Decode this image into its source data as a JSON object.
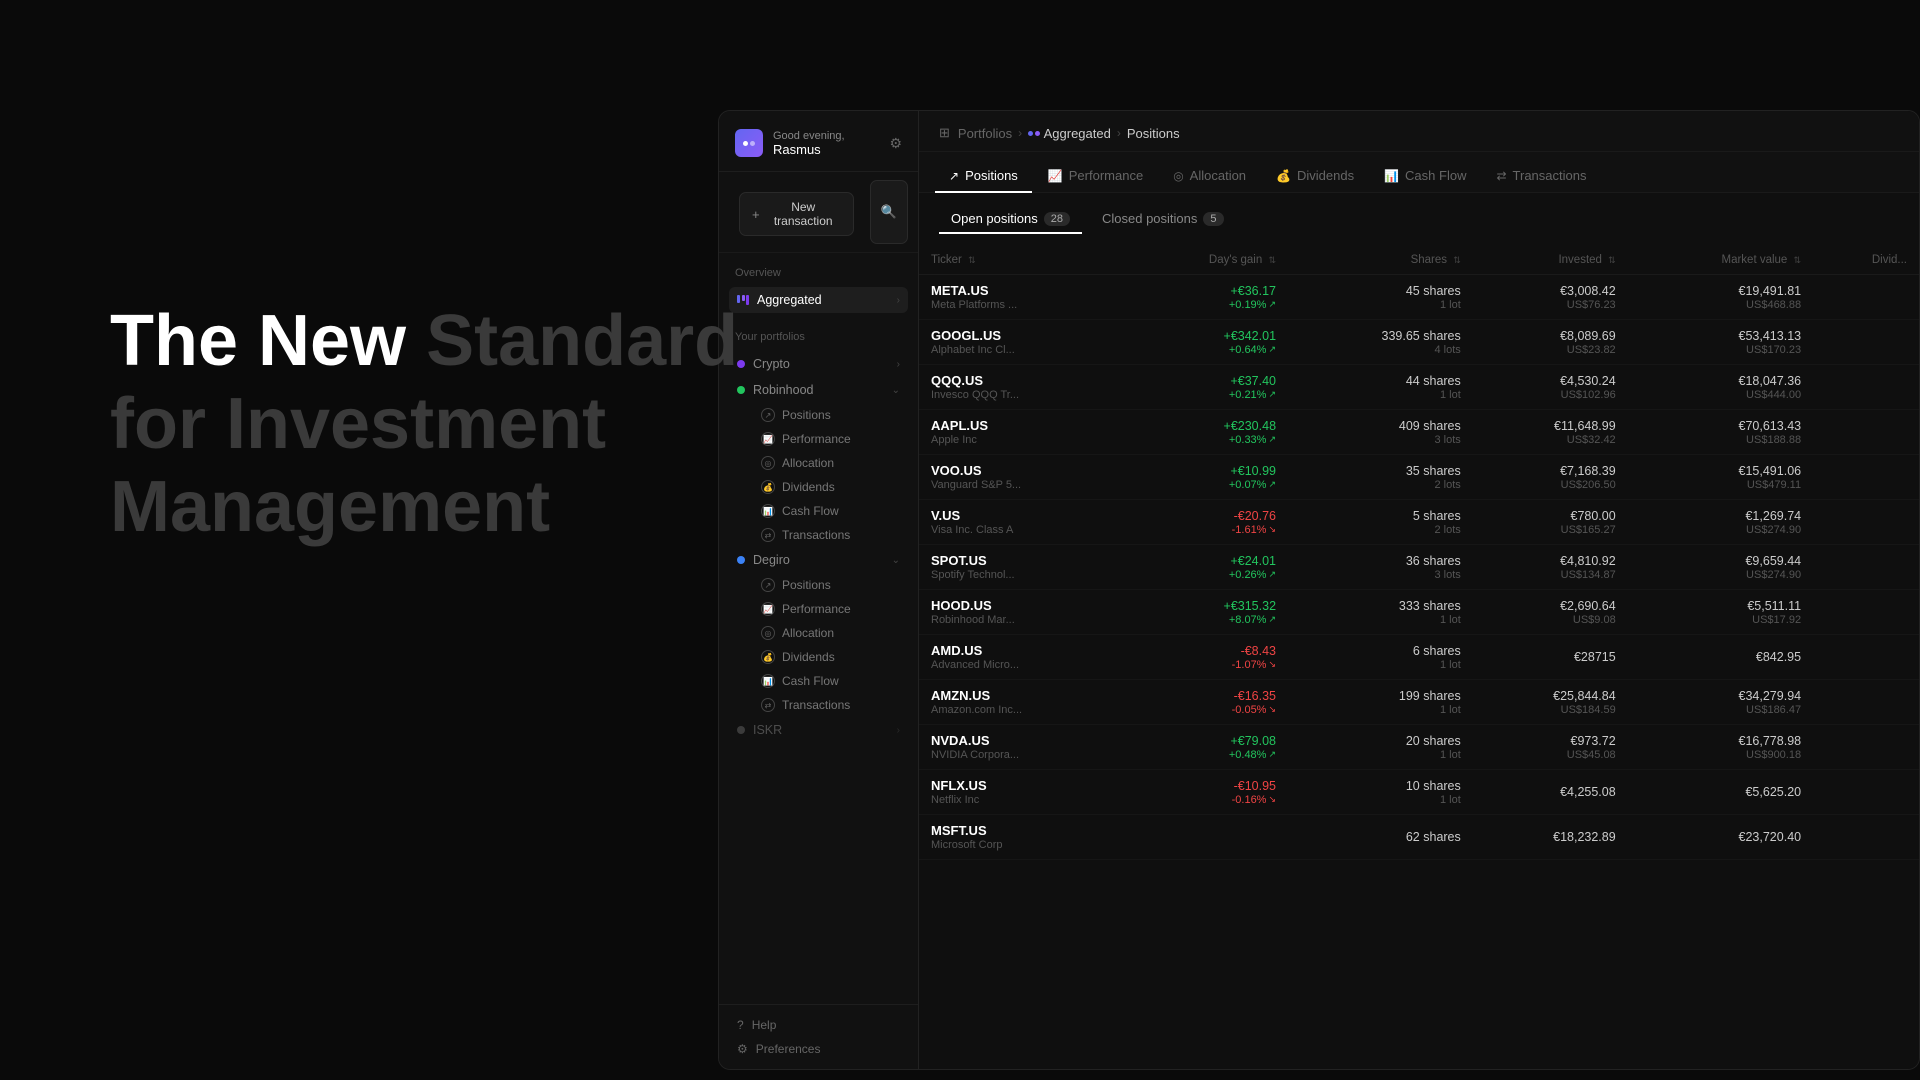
{
  "hero": {
    "line1": "The New Standard",
    "line2_normal": "for Investment",
    "line3": "Management"
  },
  "sidebar": {
    "greeting": "Good evening,",
    "username": "Rasmus",
    "new_transaction": "New transaction",
    "overview_label": "Overview",
    "aggregated_label": "Aggregated",
    "your_portfolios_label": "Your portfolios",
    "portfolios": [
      {
        "name": "Crypto",
        "dot_color": "dot-purple",
        "expanded": true
      },
      {
        "name": "Robinhood",
        "dot_color": "dot-green",
        "expanded": true
      },
      {
        "name": "Degiro",
        "dot_color": "dot-blue",
        "expanded": true
      },
      {
        "name": "ISKR",
        "dot_color": "dot-gray",
        "expanded": false
      }
    ],
    "robinhood_subitems": [
      "Positions",
      "Performance",
      "Allocation",
      "Dividends",
      "Cash Flow",
      "Transactions"
    ],
    "degiro_subitems": [
      "Positions",
      "Performance",
      "Allocation",
      "Dividends",
      "Cash Flow",
      "Transactions"
    ],
    "help_label": "Help",
    "preferences_label": "Preferences"
  },
  "breadcrumb": {
    "portfolios": "Portfolios",
    "aggregated": "Aggregated",
    "positions": "Positions"
  },
  "tabs": [
    {
      "label": "Positions",
      "icon": "↗"
    },
    {
      "label": "Performance",
      "icon": "📈"
    },
    {
      "label": "Allocation",
      "icon": "◎"
    },
    {
      "label": "Dividends",
      "icon": "💰"
    },
    {
      "label": "Cash Flow",
      "icon": "📊"
    },
    {
      "label": "Transactions",
      "icon": "⇄"
    }
  ],
  "positions": {
    "open_label": "Open positions",
    "open_count": "28",
    "closed_label": "Closed positions",
    "closed_count": "5"
  },
  "table": {
    "columns": [
      "Ticker",
      "Day's gain",
      "Shares",
      "Invested",
      "Market value",
      "Divid..."
    ],
    "rows": [
      {
        "ticker": "META.US",
        "name": "Meta Platforms ...",
        "gain": "+€36.17",
        "gain_pct": "+0.19%",
        "shares": "45 shares",
        "lots": "1 lot",
        "invested": "€3,008.42",
        "invested_usd": "US$76.23",
        "market_value": "€19,491.81",
        "market_usd": "US$468.88",
        "positive": true
      },
      {
        "ticker": "GOOGL.US",
        "name": "Alphabet Inc Cl...",
        "gain": "+€342.01",
        "gain_pct": "+0.64%",
        "shares": "339.65 shares",
        "lots": "4 lots",
        "invested": "€8,089.69",
        "invested_usd": "US$23.82",
        "market_value": "€53,413.13",
        "market_usd": "US$170.23",
        "positive": true
      },
      {
        "ticker": "QQQ.US",
        "name": "Invesco QQQ Tr...",
        "gain": "+€37.40",
        "gain_pct": "+0.21%",
        "shares": "44 shares",
        "lots": "1 lot",
        "invested": "€4,530.24",
        "invested_usd": "US$102.96",
        "market_value": "€18,047.36",
        "market_usd": "US$444.00",
        "positive": true
      },
      {
        "ticker": "AAPL.US",
        "name": "Apple Inc",
        "gain": "+€230.48",
        "gain_pct": "+0.33%",
        "shares": "409 shares",
        "lots": "3 lots",
        "invested": "€11,648.99",
        "invested_usd": "US$32.42",
        "market_value": "€70,613.43",
        "market_usd": "US$188.88",
        "positive": true
      },
      {
        "ticker": "VOO.US",
        "name": "Vanguard S&P 5...",
        "gain": "+€10.99",
        "gain_pct": "+0.07%",
        "shares": "35 shares",
        "lots": "2 lots",
        "invested": "€7,168.39",
        "invested_usd": "US$206.50",
        "market_value": "€15,491.06",
        "market_usd": "US$479.11",
        "positive": true
      },
      {
        "ticker": "V.US",
        "name": "Visa Inc. Class A",
        "gain": "-€20.76",
        "gain_pct": "-1.61%",
        "shares": "5 shares",
        "lots": "2 lots",
        "invested": "€780.00",
        "invested_usd": "US$165.27",
        "market_value": "€1,269.74",
        "market_usd": "US$274.90",
        "positive": false
      },
      {
        "ticker": "SPOT.US",
        "name": "Spotify Technol...",
        "gain": "+€24.01",
        "gain_pct": "+0.26%",
        "shares": "36 shares",
        "lots": "3 lots",
        "invested": "€4,810.92",
        "invested_usd": "US$134.87",
        "market_value": "€9,659.44",
        "market_usd": "US$274.90",
        "positive": true
      },
      {
        "ticker": "HOOD.US",
        "name": "Robinhood Mar...",
        "gain": "+€315.32",
        "gain_pct": "+8.07%",
        "shares": "333 shares",
        "lots": "1 lot",
        "invested": "€2,690.64",
        "invested_usd": "US$9.08",
        "market_value": "€5,511.11",
        "market_usd": "US$17.92",
        "positive": true
      },
      {
        "ticker": "AMD.US",
        "name": "Advanced Micro...",
        "gain": "-€8.43",
        "gain_pct": "-1.07%",
        "shares": "6 shares",
        "lots": "1 lot",
        "invested": "€28715",
        "invested_usd": "",
        "market_value": "€842.95",
        "market_usd": "",
        "positive": false
      },
      {
        "ticker": "AMZN.US",
        "name": "Amazon.com Inc...",
        "gain": "-€16.35",
        "gain_pct": "-0.05%",
        "shares": "199 shares",
        "lots": "1 lot",
        "invested": "€25,844.84",
        "invested_usd": "US$184.59",
        "market_value": "€34,279.94",
        "market_usd": "US$186.47",
        "positive": false
      },
      {
        "ticker": "NVDA.US",
        "name": "NVIDIA Corpora...",
        "gain": "+€79.08",
        "gain_pct": "+0.48%",
        "shares": "20 shares",
        "lots": "1 lot",
        "invested": "€973.72",
        "invested_usd": "US$45.08",
        "market_value": "€16,778.98",
        "market_usd": "US$900.18",
        "positive": true
      },
      {
        "ticker": "NFLX.US",
        "name": "Netflix Inc",
        "gain": "-€10.95",
        "gain_pct": "-0.16%",
        "shares": "10 shares",
        "lots": "1 lot",
        "invested": "€4,255.08",
        "invested_usd": "",
        "market_value": "€5,625.20",
        "market_usd": "",
        "positive": false
      },
      {
        "ticker": "MSFT.US",
        "name": "Microsoft Corp",
        "gain": "",
        "gain_pct": "",
        "shares": "62 shares",
        "lots": "",
        "invested": "€18,232.89",
        "invested_usd": "",
        "market_value": "€23,720.40",
        "market_usd": "",
        "positive": true
      }
    ]
  }
}
